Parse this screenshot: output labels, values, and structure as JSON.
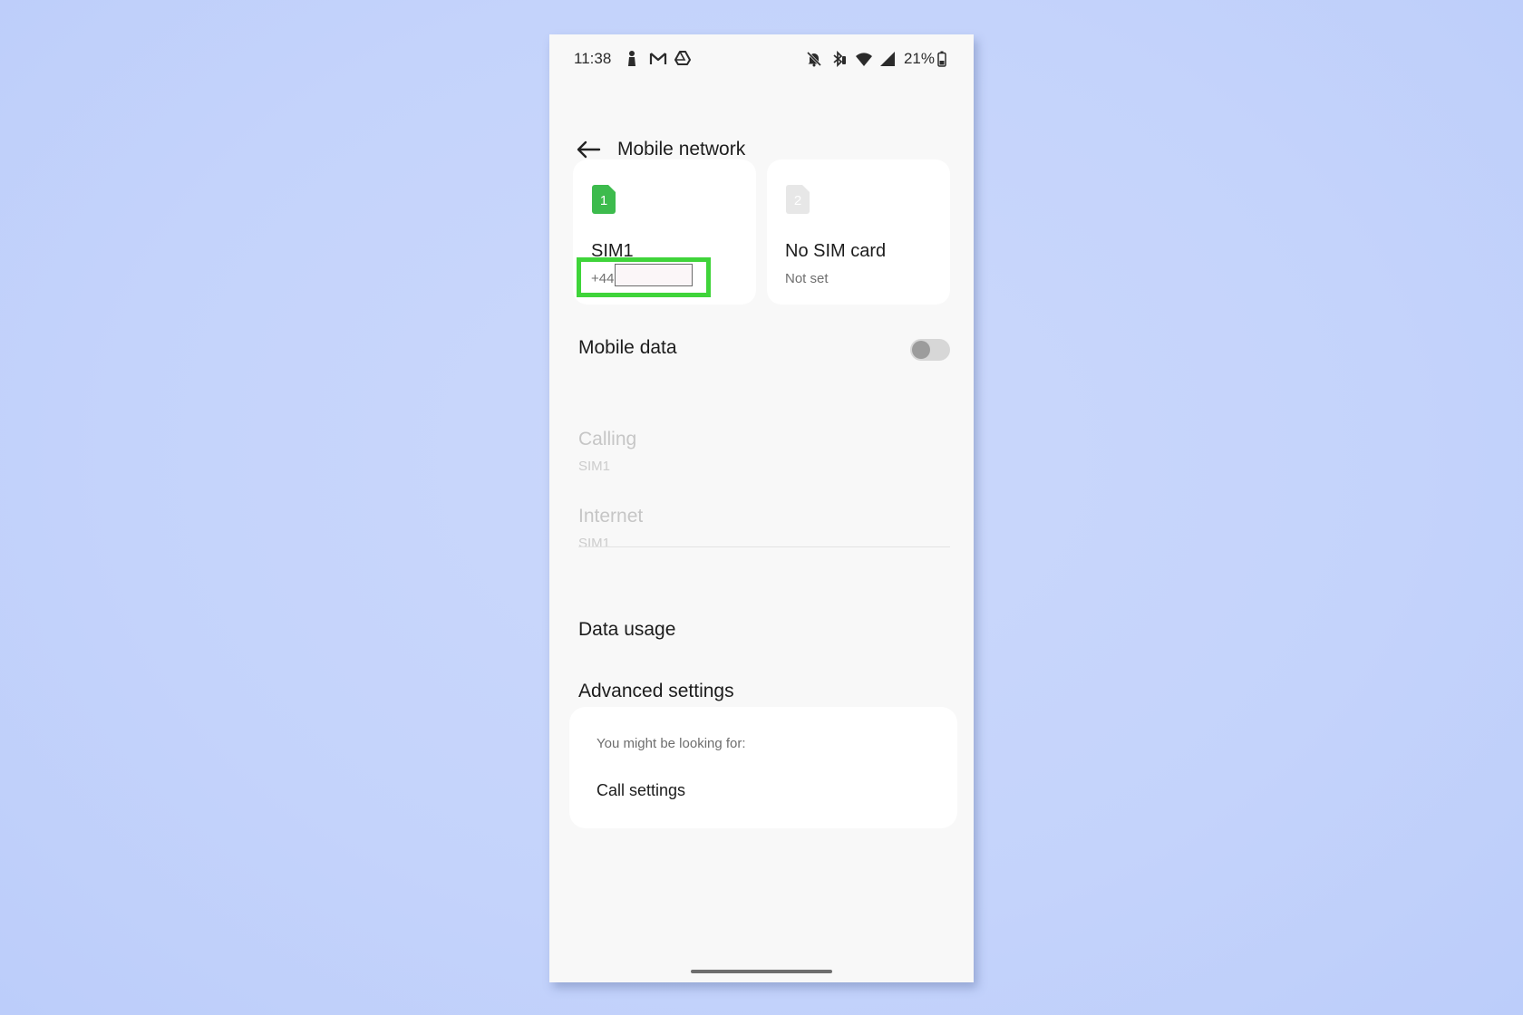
{
  "status_bar": {
    "time": "11:38",
    "battery": "21%",
    "left_icons": [
      "person-icon",
      "gmail-icon",
      "drive-icon"
    ],
    "right_icons": [
      "bell-off-icon",
      "bluetooth-icon",
      "wifi-icon",
      "signal-icon",
      "battery-icon"
    ]
  },
  "header": {
    "title": "Mobile network"
  },
  "sims": [
    {
      "slot": "1",
      "name": "SIM1",
      "number": "+44",
      "color": "#3dbb4d"
    },
    {
      "slot": "2",
      "name": "No SIM card",
      "status": "Not set",
      "color": "#e7e7e7"
    }
  ],
  "settings": {
    "mobile_data": {
      "label": "Mobile data",
      "enabled": false
    },
    "calling": {
      "label": "Calling",
      "value": "SIM1"
    },
    "internet": {
      "label": "Internet",
      "value": "SIM1"
    },
    "data_usage": "Data usage",
    "advanced_settings": "Advanced settings"
  },
  "suggestions": {
    "heading": "You might be looking for:",
    "items": [
      "Call settings"
    ]
  },
  "colors": {
    "highlight": "#3fd43a",
    "sim_active": "#3dbb4d",
    "background": "#c4d3fb"
  }
}
